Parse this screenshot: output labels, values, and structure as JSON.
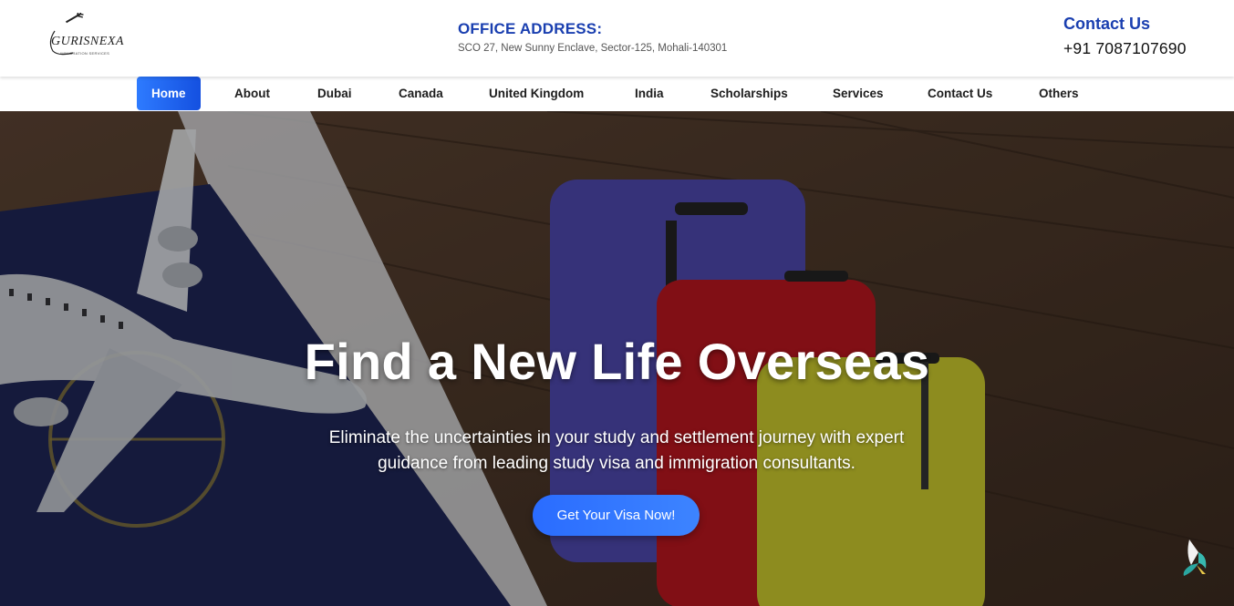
{
  "brand": {
    "logo_text": "GURISNEXA",
    "logo_subtext": "IMMIGRATION SERVICES",
    "logo_icon": "airplane-icon"
  },
  "header": {
    "office_title": "OFFICE ADDRESS:",
    "office_address": "SCO 27, New Sunny Enclave, Sector-125, Mohali-140301",
    "contact_title": "Contact Us",
    "contact_phone": "+91 7087107690"
  },
  "nav": {
    "items": [
      {
        "label": "Home",
        "active": true
      },
      {
        "label": "About"
      },
      {
        "label": "Dubai"
      },
      {
        "label": "Canada"
      },
      {
        "label": "United Kingdom"
      },
      {
        "label": "India"
      },
      {
        "label": "Scholarships"
      },
      {
        "label": "Services"
      },
      {
        "label": "Contact Us"
      },
      {
        "label": "Others"
      }
    ]
  },
  "hero": {
    "title": "Find a New Life Overseas",
    "subtitle": "Eliminate the uncertainties in your study and settlement journey with expert guidance from leading study visa and immigration consultants.",
    "cta_label": "Get Your Visa Now!",
    "side_widget_icon": "bird-widget-icon"
  },
  "colors": {
    "brand_blue": "#1a3fb0",
    "accent_blue": "#2a6cff",
    "text_dark": "#1d1d1d"
  }
}
